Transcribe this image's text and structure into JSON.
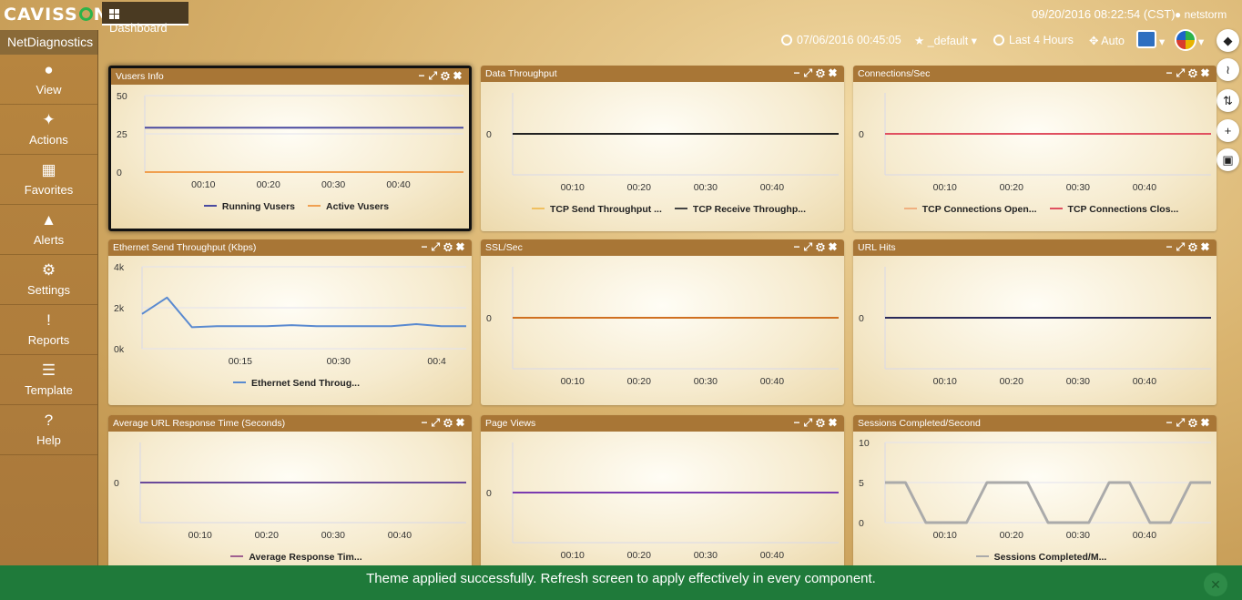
{
  "header": {
    "logo": "CAVISSON",
    "logo_parts": [
      "CAVISS",
      "N"
    ],
    "tab": "Dashboard",
    "app": "NetDiagnostics",
    "datetime": "09/20/2016 08:22:54 (CST)",
    "user": "netstorm",
    "start_time": "07/06/2016 00:45:05",
    "favorite": "_default",
    "range": "Last 4 Hours",
    "refresh": "Auto"
  },
  "sidebar": [
    {
      "label": "View",
      "icon": "user-icon"
    },
    {
      "label": "Actions",
      "icon": "puzzle-icon"
    },
    {
      "label": "Favorites",
      "icon": "grid-icon"
    },
    {
      "label": "Alerts",
      "icon": "bell-icon"
    },
    {
      "label": "Settings",
      "icon": "gear-icon"
    },
    {
      "label": "Reports",
      "icon": "alert-icon"
    },
    {
      "label": "Template",
      "icon": "template-icon"
    },
    {
      "label": "Help",
      "icon": "help-icon"
    }
  ],
  "panels": [
    {
      "title": "Vusers Info",
      "yticks": [
        "50",
        "25",
        "0"
      ],
      "xticks": [
        "00:10",
        "00:20",
        "00:30",
        "00:40"
      ],
      "legend": [
        {
          "name": "Running Vusers",
          "color": "#4a4aa0"
        },
        {
          "name": "Active Vusers",
          "color": "#f0a050"
        }
      ]
    },
    {
      "title": "Data Throughput",
      "yticks": [
        "0"
      ],
      "xticks": [
        "00:10",
        "00:20",
        "00:30",
        "00:40"
      ],
      "legend": [
        {
          "name": "TCP Send Throughput ...",
          "color": "#f0c060"
        },
        {
          "name": "TCP Receive Throughp...",
          "color": "#444444"
        }
      ]
    },
    {
      "title": "Connections/Sec",
      "yticks": [
        "0"
      ],
      "xticks": [
        "00:10",
        "00:20",
        "00:30",
        "00:40"
      ],
      "legend": [
        {
          "name": "TCP Connections Open...",
          "color": "#f0b080"
        },
        {
          "name": "TCP Connections Clos...",
          "color": "#e05060"
        }
      ]
    },
    {
      "title": "Ethernet Send Throughput (Kbps)",
      "yticks": [
        "4k",
        "2k",
        "0k"
      ],
      "xticks": [
        "00:15",
        "00:30",
        "00:4"
      ],
      "legend": [
        {
          "name": "Ethernet Send Throug...",
          "color": "#5a8ad0"
        }
      ]
    },
    {
      "title": "SSL/Sec",
      "yticks": [
        "0"
      ],
      "xticks": [
        "00:10",
        "00:20",
        "00:30",
        "00:40"
      ],
      "legend": []
    },
    {
      "title": "URL Hits",
      "yticks": [
        "0"
      ],
      "xticks": [
        "00:10",
        "00:20",
        "00:30",
        "00:40"
      ],
      "legend": []
    },
    {
      "title": "Average URL Response Time (Seconds)",
      "yticks": [
        "0"
      ],
      "xticks": [
        "00:10",
        "00:20",
        "00:30",
        "00:40"
      ],
      "legend": [
        {
          "name": "Average Response Tim...",
          "color": "#a06090"
        }
      ]
    },
    {
      "title": "Page Views",
      "yticks": [
        "0"
      ],
      "xticks": [
        "00:10",
        "00:20",
        "00:30",
        "00:40"
      ],
      "legend": []
    },
    {
      "title": "Sessions Completed/Second",
      "yticks": [
        "10",
        "5",
        "0"
      ],
      "xticks": [
        "00:10",
        "00:20",
        "00:30",
        "00:40"
      ],
      "legend": [
        {
          "name": "Sessions Completed/M...",
          "color": "#aaaaaa"
        }
      ]
    }
  ],
  "chart_data": [
    {
      "type": "line",
      "title": "Vusers Info",
      "ylim": [
        0,
        50
      ],
      "series": [
        {
          "name": "Running Vusers",
          "values": [
            29,
            29,
            29,
            29,
            29,
            29
          ]
        },
        {
          "name": "Active Vusers",
          "values": [
            0,
            0,
            0,
            0,
            0,
            0
          ]
        }
      ]
    },
    {
      "type": "line",
      "title": "Data Throughput",
      "series": [
        {
          "name": "TCP Send Throughput ...",
          "values": [
            0,
            0,
            0,
            0,
            0
          ]
        },
        {
          "name": "TCP Receive Throughp...",
          "values": [
            0,
            0,
            0,
            0,
            0
          ]
        }
      ]
    },
    {
      "type": "line",
      "title": "Connections/Sec",
      "series": [
        {
          "name": "TCP Connections Open...",
          "values": [
            0,
            0,
            0,
            0,
            0
          ]
        },
        {
          "name": "TCP Connections Clos...",
          "values": [
            0,
            0,
            0,
            0,
            0
          ]
        }
      ]
    },
    {
      "type": "line",
      "title": "Ethernet Send Throughput (Kbps)",
      "ylim": [
        0,
        4000
      ],
      "series": [
        {
          "name": "Ethernet Send Throug...",
          "values": [
            1700,
            2500,
            1050,
            1100,
            1100,
            1100,
            1150,
            1100,
            1100,
            1100,
            1100,
            1200,
            1100,
            1100
          ]
        }
      ]
    },
    {
      "type": "line",
      "title": "SSL/Sec",
      "series": [
        {
          "values": [
            0,
            0,
            0,
            0,
            0
          ]
        }
      ]
    },
    {
      "type": "line",
      "title": "URL Hits",
      "series": [
        {
          "values": [
            0,
            0,
            0,
            0,
            0
          ]
        }
      ]
    },
    {
      "type": "line",
      "title": "Average URL Response Time (Seconds)",
      "series": [
        {
          "name": "Average Response Tim...",
          "values": [
            0,
            0,
            0,
            0,
            0
          ]
        }
      ]
    },
    {
      "type": "line",
      "title": "Page Views",
      "series": [
        {
          "values": [
            0,
            0,
            0,
            0,
            0
          ]
        }
      ]
    },
    {
      "type": "line",
      "title": "Sessions Completed/Second",
      "ylim": [
        0,
        10
      ],
      "series": [
        {
          "name": "Sessions Completed/M...",
          "values": [
            5,
            5,
            0,
            0,
            0,
            5,
            5,
            5,
            0,
            0,
            0,
            5,
            5,
            0,
            0,
            5,
            5
          ]
        }
      ]
    }
  ],
  "toast": "Theme applied successfully. Refresh screen to apply effectively in every component."
}
